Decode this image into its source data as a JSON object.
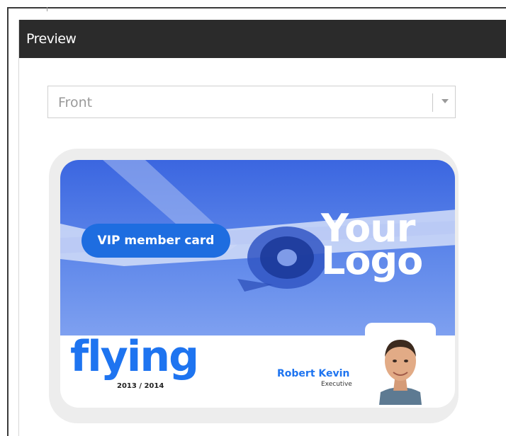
{
  "panel": {
    "title": "Preview"
  },
  "side_select": {
    "value": "Front"
  },
  "card": {
    "badge": "VIP member card",
    "logo_line1": "Your",
    "logo_line2": "Logo",
    "headline": "flying",
    "years": "2013 / 2014",
    "person_name": "Robert Kevin",
    "person_role": "Executive"
  },
  "colors": {
    "header_bg": "#2b2b2b",
    "card_blue": "#5f88ea",
    "accent_blue": "#1e74f0"
  }
}
